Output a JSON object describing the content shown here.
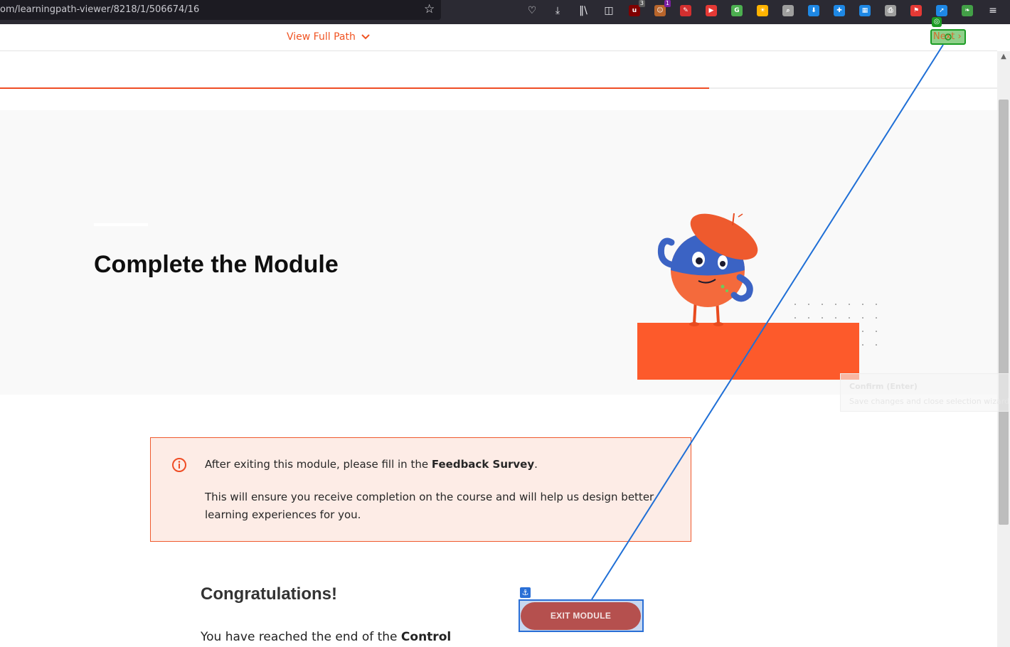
{
  "browser": {
    "url": "om/learningpath-viewer/8218/1/506674/16",
    "toolbar_icons": [
      {
        "name": "pocket-icon",
        "glyph": "♡"
      },
      {
        "name": "download-icon",
        "glyph": "⤓"
      },
      {
        "name": "library-icon",
        "glyph": "‖\\"
      },
      {
        "name": "sidebar-icon",
        "glyph": "◫"
      },
      {
        "name": "ublock-icon",
        "glyph": "u",
        "color": "#800000",
        "badge": "3",
        "badge_color": "#5a5a5a"
      },
      {
        "name": "monkey-icon",
        "glyph": "☺",
        "color": "#b8652b",
        "badge": "1",
        "badge_color": "#7b1fa2"
      },
      {
        "name": "pen-icon",
        "glyph": "✎",
        "color": "#d32f2f"
      },
      {
        "name": "youtube-icon",
        "glyph": "▶",
        "color": "#e53935"
      },
      {
        "name": "translate-icon",
        "glyph": "G",
        "color": "#4caf50"
      },
      {
        "name": "brightness-icon",
        "glyph": "☀",
        "color": "#ffb300"
      },
      {
        "name": "magnifier-icon",
        "glyph": "⌕",
        "color": "#9e9e9e"
      },
      {
        "name": "down-arrow-icon",
        "glyph": "⬇",
        "color": "#1e88e5"
      },
      {
        "name": "cross-icon",
        "glyph": "✚",
        "color": "#1e88e5"
      },
      {
        "name": "clapper-icon",
        "glyph": "▦",
        "color": "#1e88e5"
      },
      {
        "name": "puzzle-icon",
        "glyph": "⎙",
        "color": "#9e9e9e"
      },
      {
        "name": "flag-icon",
        "glyph": "⚑",
        "color": "#e53935"
      },
      {
        "name": "arrow-icon",
        "glyph": "➚",
        "color": "#1e88e5"
      },
      {
        "name": "leaf-icon",
        "glyph": "❧",
        "color": "#43a047"
      },
      {
        "name": "menu-icon",
        "glyph": "≡"
      }
    ]
  },
  "header": {
    "view_full_path": "View Full Path",
    "next_label": "Next",
    "next_arrow": "›"
  },
  "progress": {
    "fraction": 0.711
  },
  "hero": {
    "title": "Complete the Module"
  },
  "notice": {
    "line1_prefix": "After exiting this module, please fill in the ",
    "line1_bold": "Feedback Survey",
    "line1_suffix": ".",
    "line2": "This will ensure you receive completion on the course and will help us design better learning experiences for you."
  },
  "content": {
    "congrats": "Congratulations!",
    "reached_prefix": "You have reached the end of the ",
    "reached_bold": "Control"
  },
  "exit_button": {
    "label": "EXIT MODULE"
  },
  "tooltip": {
    "title": "Confirm (Enter)",
    "description": "Save changes and close selection wizard."
  },
  "colors": {
    "accent": "#f05423",
    "exit_button": "#b5504e",
    "selection_blue": "#2a6fd6",
    "selection_green": "#1b9c24"
  }
}
